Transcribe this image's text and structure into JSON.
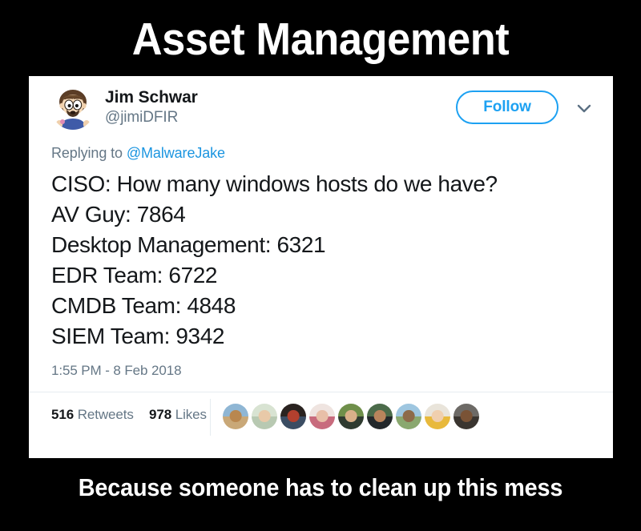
{
  "meme": {
    "top_caption": "Asset Management",
    "bottom_caption": "Because someone has to clean up this mess",
    "background_color": "#000000",
    "caption_color": "#ffffff"
  },
  "tweet": {
    "author": {
      "display_name": "Jim Schwar",
      "handle": "@jimiDFIR",
      "avatar_icon": "cartoon-avatar-icon"
    },
    "follow_label": "Follow",
    "caret_icon": "chevron-down-icon",
    "reply_context": {
      "prefix": "Replying to",
      "mention": "@MalwareJake"
    },
    "body_lines": [
      "CISO: How many windows hosts do we have?",
      "AV Guy: 7864",
      "Desktop Management: 6321",
      "EDR Team: 6722",
      "CMDB Team: 4848",
      "SIEM Team: 9342"
    ],
    "timestamp": "1:55 PM - 8 Feb 2018",
    "stats": {
      "retweets_count": "516",
      "retweets_label": "Retweets",
      "likes_count": "978",
      "likes_label": "Likes"
    },
    "facepile": [
      {
        "name": "liker-avatar-1",
        "top": "#8fb6d4",
        "bottom": "#c9a878",
        "head": "#b9874f"
      },
      {
        "name": "liker-avatar-2",
        "top": "#d8e3d2",
        "bottom": "#b8c9b2",
        "head": "#e8c9a8"
      },
      {
        "name": "liker-avatar-3",
        "top": "#2a2320",
        "bottom": "#3b4d63",
        "head": "#b3402e"
      },
      {
        "name": "liker-avatar-4",
        "top": "#efe4e0",
        "bottom": "#c86b7d",
        "head": "#e8bfa8"
      },
      {
        "name": "liker-avatar-5",
        "top": "#6f8f4a",
        "bottom": "#2f3b30",
        "head": "#d9b089"
      },
      {
        "name": "liker-avatar-6",
        "top": "#4b6b4a",
        "bottom": "#23282b",
        "head": "#b9845c"
      },
      {
        "name": "liker-avatar-7",
        "top": "#9ec6e0",
        "bottom": "#8aa86f",
        "head": "#8d6a4a"
      },
      {
        "name": "liker-avatar-8",
        "top": "#e9e4da",
        "bottom": "#e8b93c",
        "head": "#f0cfae"
      },
      {
        "name": "liker-avatar-9",
        "top": "#6d6a66",
        "bottom": "#3a3530",
        "head": "#7a5336"
      }
    ],
    "colors": {
      "card_background": "#ffffff",
      "accent_blue": "#1da1f2",
      "link_blue": "#1b95e0",
      "muted_text": "#657786",
      "primary_text": "#14171a",
      "divider": "#e6ecf0"
    }
  }
}
